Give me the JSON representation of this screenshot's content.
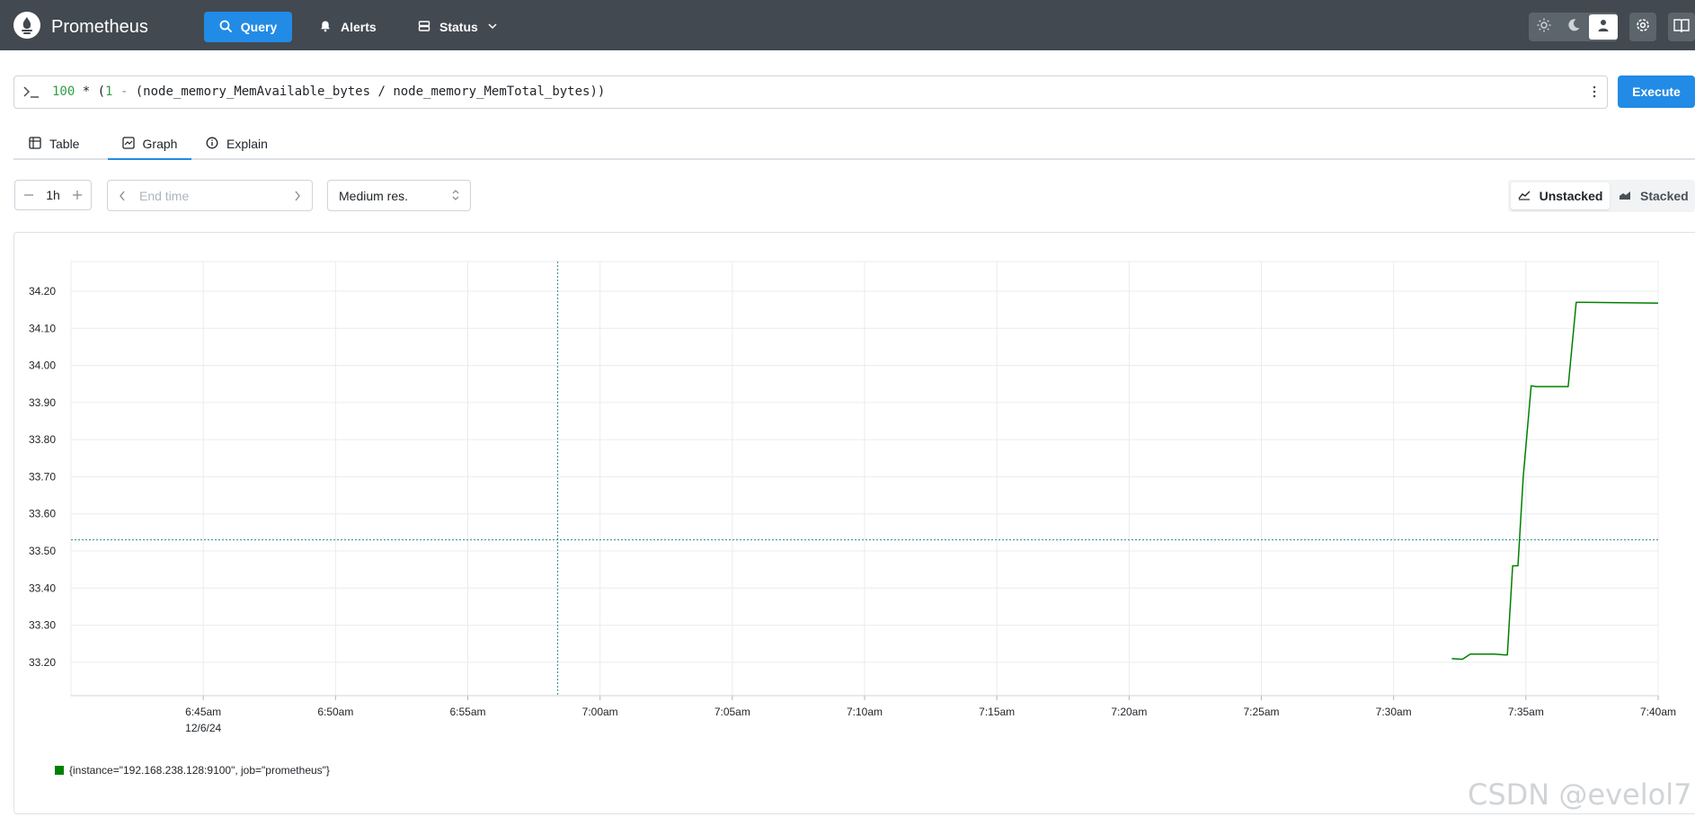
{
  "header": {
    "app_title": "Prometheus",
    "nav": {
      "query_label": "Query",
      "alerts_label": "Alerts",
      "status_label": "Status"
    },
    "icons": [
      "prometheus-logo-icon",
      "search-icon",
      "bell-icon",
      "server-icon",
      "chevron-down-icon",
      "sun-icon",
      "moon-icon",
      "user-icon",
      "gear-icon",
      "book-icon"
    ],
    "active_theme": "user"
  },
  "query": {
    "parts": {
      "num": "100",
      "op1": " * (",
      "one": "1",
      "op2": " - ",
      "expr": "(node_memory_MemAvailable_bytes / node_memory_MemTotal_bytes))"
    },
    "execute_label": "Execute"
  },
  "tabs": {
    "table_label": "Table",
    "graph_label": "Graph",
    "explain_label": "Explain",
    "active": "Graph"
  },
  "controls": {
    "range_value": "1h",
    "end_time_placeholder": "End time",
    "resolution_value": "Medium res.",
    "unstacked_label": "Unstacked",
    "stacked_label": "Stacked",
    "stack_mode": "Unstacked"
  },
  "colors": {
    "accent": "#228be6",
    "header_bg": "#424950",
    "series": "#008000"
  },
  "chart_data": {
    "type": "line",
    "y_ticks": [
      "34.20",
      "34.10",
      "34.00",
      "33.90",
      "33.80",
      "33.70",
      "33.60",
      "33.50",
      "33.40",
      "33.30",
      "33.20"
    ],
    "ylim": [
      33.11,
      34.28
    ],
    "x_ticks": [
      "6:45am",
      "6:50am",
      "6:55am",
      "7:00am",
      "7:05am",
      "7:10am",
      "7:15am",
      "7:20am",
      "7:25am",
      "7:30am",
      "7:35am",
      "7:40am"
    ],
    "x_tick_minutes": [
      45,
      50,
      55,
      60,
      65,
      70,
      75,
      80,
      85,
      90,
      95,
      100
    ],
    "x_date_label": "12/6/24",
    "xlim_minutes": [
      40,
      100
    ],
    "grid": true,
    "cursor": {
      "x_minutes": 58.4,
      "y": 33.53
    },
    "series": [
      {
        "name": "{instance=\"192.168.238.128:9100\", job=\"prometheus\"}",
        "color": "#008000",
        "x_minutes": [
          92.2,
          92.6,
          92.9,
          93.8,
          94.2,
          94.3,
          94.5,
          94.7,
          94.9,
          95.2,
          95.4,
          95.6,
          96.6,
          96.9,
          97.3,
          100
        ],
        "values": [
          33.21,
          33.208,
          33.222,
          33.222,
          33.22,
          33.22,
          33.46,
          33.46,
          33.7,
          33.945,
          33.943,
          33.943,
          33.943,
          34.17,
          34.17,
          34.168
        ]
      }
    ]
  },
  "watermark": "CSDN @evelol7"
}
